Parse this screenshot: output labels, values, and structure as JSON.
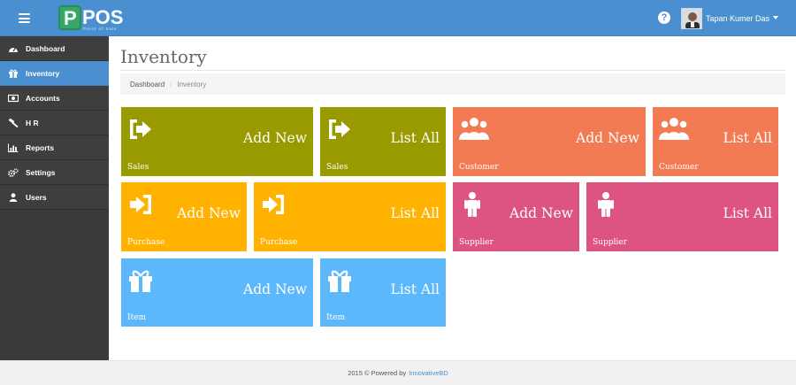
{
  "header": {
    "logo_text": "POS",
    "logo_tagline": "Point of Sale",
    "user_name": "Tapan Kumer Das",
    "help_glyph": "?"
  },
  "sidebar": {
    "items": [
      {
        "label": "Dashboard",
        "icon": "dashboard-icon"
      },
      {
        "label": "Inventory",
        "icon": "gift-icon",
        "active": true
      },
      {
        "label": "Accounts",
        "icon": "money-icon"
      },
      {
        "label": "H R",
        "icon": "gavel-icon"
      },
      {
        "label": "Reports",
        "icon": "bar-chart-icon"
      },
      {
        "label": "Settings",
        "icon": "cogs-icon"
      },
      {
        "label": "Users",
        "icon": "user-icon"
      }
    ]
  },
  "page": {
    "title": "Inventory",
    "breadcrumb": [
      "Dashboard",
      "Inventory"
    ]
  },
  "tiles": [
    {
      "action": "Add New",
      "label": "Sales",
      "color": "#999900",
      "icon": "sign-in-icon"
    },
    {
      "action": "List All",
      "label": "Sales",
      "color": "#999900",
      "icon": "sign-in-icon"
    },
    {
      "action": "Add New",
      "label": "Customer",
      "color": "#f37b53",
      "icon": "users-icon"
    },
    {
      "action": "List All",
      "label": "Customer",
      "color": "#f37b53",
      "icon": "users-icon"
    },
    {
      "action": "Add New",
      "label": "Purchase",
      "color": "#ffb300",
      "icon": "sign-in-box-icon"
    },
    {
      "action": "List All",
      "label": "Purchase",
      "color": "#ffb300",
      "icon": "sign-in-box-icon"
    },
    {
      "action": "Add New",
      "label": "Supplier",
      "color": "#de5481",
      "icon": "male-icon"
    },
    {
      "action": "List All",
      "label": "Supplier",
      "color": "#de5481",
      "icon": "male-icon"
    },
    {
      "action": "Add New",
      "label": "Item",
      "color": "#5cb8fb",
      "icon": "gift-icon"
    },
    {
      "action": "List All",
      "label": "Item",
      "color": "#5cb8fb",
      "icon": "gift-icon"
    }
  ],
  "footer": {
    "text": "2015 © Powered by",
    "link": "InnovativeBD"
  },
  "colors": {
    "brand": "#4a90d0",
    "sidebar": "#3a3a3a"
  }
}
